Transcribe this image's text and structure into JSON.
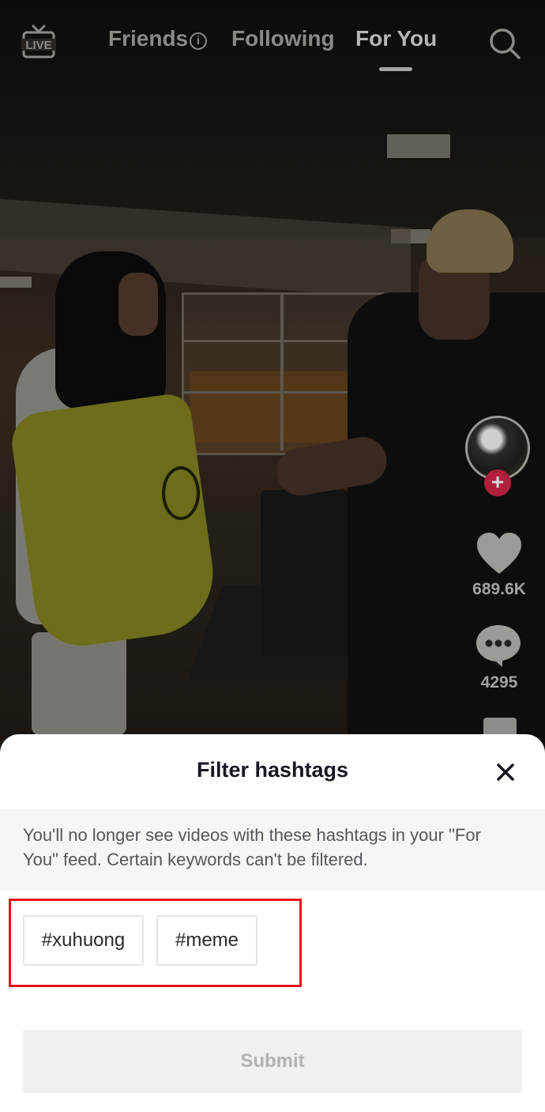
{
  "top_nav": {
    "live_label": "LIVE",
    "tabs": [
      {
        "label": "Friends",
        "active": false,
        "has_info_icon": true
      },
      {
        "label": "Following",
        "active": false
      },
      {
        "label": "For You",
        "active": true
      }
    ],
    "info_glyph": "i",
    "search_icon": "search-icon"
  },
  "side_rail": {
    "follow_glyph": "+",
    "like_count": "689.6K",
    "comment_count": "4295"
  },
  "sheet": {
    "title": "Filter hashtags",
    "notice": "You'll no longer see videos with these hashtags in your \"For You\" feed. Certain keywords can't be filtered.",
    "hashtags": [
      "#xuhuong",
      "#meme"
    ],
    "submit_label": "Submit",
    "submit_enabled": false,
    "highlight_color": "#e3141c"
  }
}
